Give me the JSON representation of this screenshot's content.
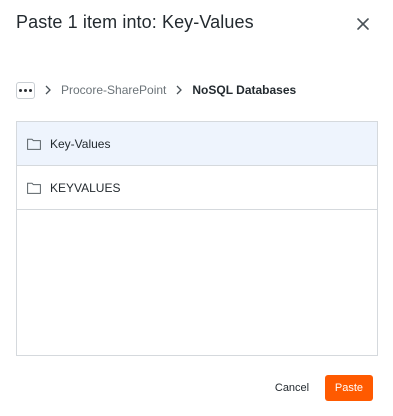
{
  "dialog": {
    "title": "Paste 1 item into: Key-Values",
    "close_icon": "close-icon"
  },
  "breadcrumb": {
    "more_icon": "more-horizontal-icon",
    "items": [
      {
        "label": "Procore-SharePoint"
      },
      {
        "label": "NoSQL Databases"
      }
    ]
  },
  "folders": [
    {
      "name": "Key-Values",
      "icon": "folder-icon",
      "selected": true
    },
    {
      "name": "KEYVALUES",
      "icon": "folder-icon",
      "selected": false
    }
  ],
  "footer": {
    "cancel_label": "Cancel",
    "paste_label": "Paste"
  },
  "colors": {
    "accent": "#ff5a00",
    "selected_row": "#eef4fd",
    "border": "#d5d9dd"
  }
}
